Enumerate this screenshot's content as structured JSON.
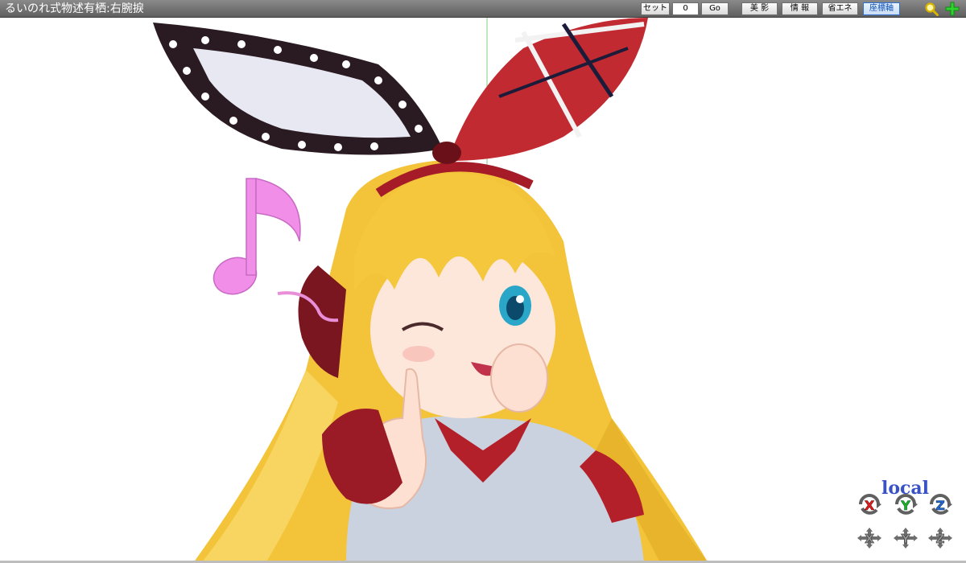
{
  "window": {
    "title": "るいのれ式物述有栖:右腕捩"
  },
  "toolbar": {
    "set_label": "セット",
    "frame_value": "0",
    "go_label": "Go",
    "shadow_label": "美 影",
    "info_label": "情 報",
    "eco_label": "省エネ",
    "axis_label": "座標軸"
  },
  "icons": {
    "zoom": "magnifier-icon",
    "add": "plus-icon"
  },
  "gizmo": {
    "mode": "local",
    "rotate": [
      "X",
      "Y",
      "Z"
    ],
    "move": [
      "X",
      "Y",
      "Z"
    ],
    "colors": {
      "x": "#e02020",
      "y": "#20b020",
      "z": "#2a66e0",
      "move": "#7a7a7a"
    }
  }
}
